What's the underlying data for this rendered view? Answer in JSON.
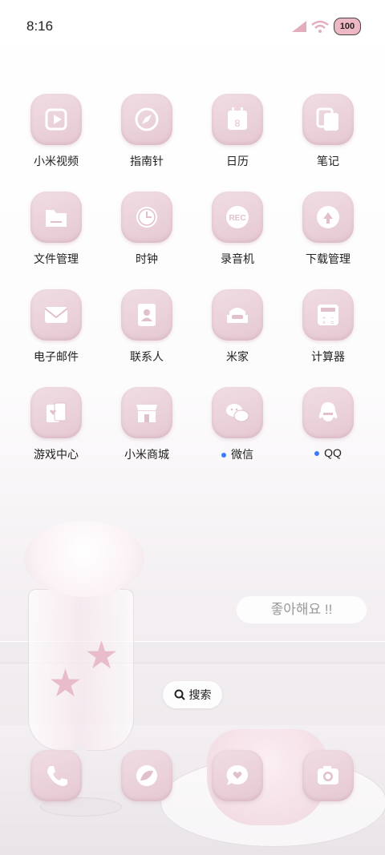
{
  "status_bar": {
    "time": "8:16",
    "battery": "100"
  },
  "apps": [
    {
      "label": "小米视频",
      "icon": "video-icon"
    },
    {
      "label": "指南针",
      "icon": "compass-icon"
    },
    {
      "label": "日历",
      "icon": "calendar-icon",
      "badge_text": "8"
    },
    {
      "label": "笔记",
      "icon": "notes-icon"
    },
    {
      "label": "文件管理",
      "icon": "folder-icon"
    },
    {
      "label": "时钟",
      "icon": "clock-icon"
    },
    {
      "label": "录音机",
      "icon": "recorder-icon",
      "badge_text": "REC"
    },
    {
      "label": "下载管理",
      "icon": "download-icon"
    },
    {
      "label": "电子邮件",
      "icon": "mail-icon"
    },
    {
      "label": "联系人",
      "icon": "contacts-icon"
    },
    {
      "label": "米家",
      "icon": "sofa-icon"
    },
    {
      "label": "计算器",
      "icon": "calculator-icon"
    },
    {
      "label": "游戏中心",
      "icon": "cards-icon"
    },
    {
      "label": "小米商城",
      "icon": "store-icon"
    },
    {
      "label": "微信",
      "icon": "wechat-icon",
      "new_dot": true
    },
    {
      "label": "QQ",
      "icon": "qq-icon",
      "new_dot": true
    }
  ],
  "wallpaper_text": "좋아해요 !!",
  "search": {
    "label": "搜索"
  },
  "dock": [
    {
      "icon": "phone-icon"
    },
    {
      "icon": "browser-icon"
    },
    {
      "icon": "messages-icon"
    },
    {
      "icon": "camera-icon"
    }
  ],
  "colors": {
    "icon_bg": "#e9ced8",
    "glyph": "#ffffff",
    "notification_dot": "#3a7bff"
  }
}
